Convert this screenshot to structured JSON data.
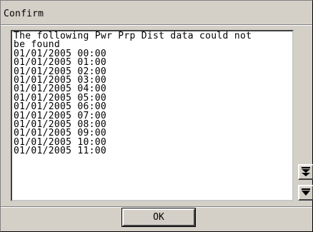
{
  "dialog": {
    "title": "Confirm",
    "message": "The following Pwr Prp Dist data could not\nbe found\n01/01/2005 00:00\n01/01/2005 01:00\n01/01/2005 02:00\n01/01/2005 03:00\n01/01/2005 04:00\n01/01/2005 05:00\n01/01/2005 06:00\n01/01/2005 07:00\n01/01/2005 08:00\n01/01/2005 09:00\n01/01/2005 10:00\n01/01/2005 11:00",
    "ok_label": "OK"
  },
  "scroll": {
    "page_down_icon": "double-chevron-down-icon",
    "line_down_icon": "triangle-down-icon"
  }
}
